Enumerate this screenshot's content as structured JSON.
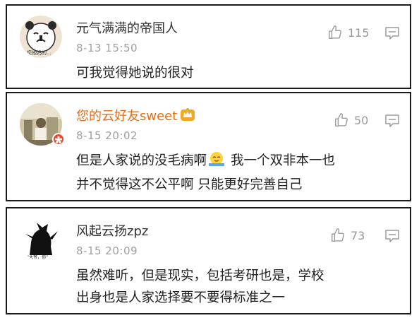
{
  "comments": [
    {
      "username": "元气满满的帝国人",
      "time": "8-13 15:50",
      "likes": "115",
      "avatar_caption": "您他妈的...",
      "lines": [
        "可我觉得她说的很对"
      ]
    },
    {
      "username": "您的云好友sweet",
      "time": "8-15 20:02",
      "likes": "50",
      "line1_a": "但是人家说的没毛病啊",
      "line1_b": "我一个双非本一也",
      "line2": "并不觉得这不公平啊 只能更好完善自己"
    },
    {
      "username": "风起云扬zpz",
      "time": "8-15 20:09",
      "likes": "73",
      "avatar_caption": "“大爷，你”",
      "lines": [
        "虽然难听，但是现实，包括考研也是，学校",
        "出身也是人家选择要不要得标准之一"
      ]
    }
  ],
  "colors": {
    "vip_name": "#e46d14",
    "name": "#333333",
    "meta": "#a0a0a0",
    "border": "#1a1a1a"
  },
  "icons": [
    "thumbs-up-icon",
    "reply-comment-icon",
    "crown-icon",
    "emoji-icon"
  ]
}
